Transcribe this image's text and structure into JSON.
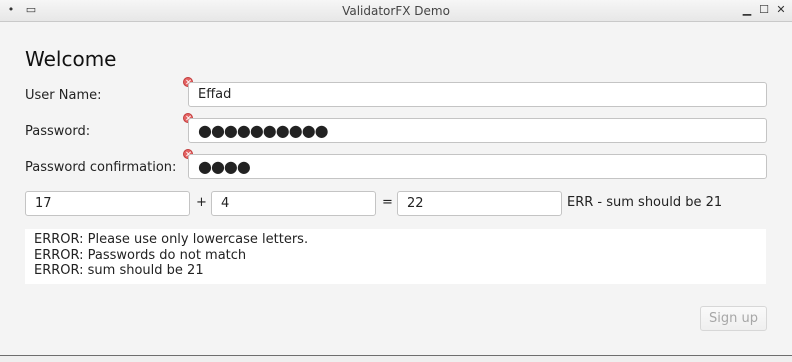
{
  "window": {
    "title": "ValidatorFX Demo",
    "left_icons": [
      "pin-icon",
      "window-menu-icon"
    ],
    "right_icons": [
      "minimize-icon",
      "maximize-icon",
      "close-icon"
    ]
  },
  "form": {
    "heading": "Welcome",
    "user_name": {
      "label": "User Name:",
      "value": "Effad",
      "has_error": true
    },
    "password": {
      "label": "Password:",
      "value": "●●●●●●●●●●",
      "has_error": true
    },
    "password_confirmation": {
      "label": "Password confirmation:",
      "value": "●●●●",
      "has_error": true
    },
    "sum": {
      "a": "17",
      "plus": "+",
      "b": "4",
      "equals": "=",
      "result": "22",
      "message": "ERR - sum should be 21"
    },
    "messages": [
      "ERROR: Please use only lowercase letters.",
      "ERROR: Passwords do not match",
      "ERROR: sum should be 21"
    ],
    "signup_button": {
      "label": "Sign up",
      "enabled": false
    }
  },
  "colors": {
    "background": "#f4f4f4",
    "error_icon": "#e46464",
    "disabled_text": "#a7a7a7"
  }
}
